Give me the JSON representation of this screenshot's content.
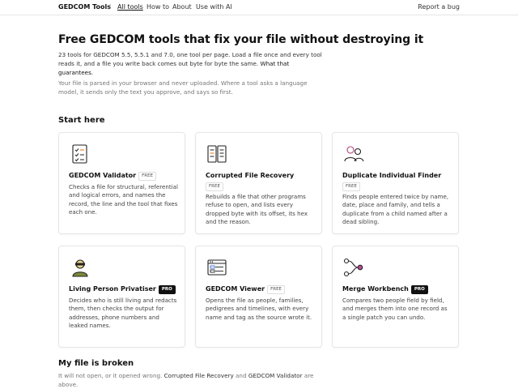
{
  "header": {
    "brand": "GEDCOM Tools",
    "separator": "/",
    "nav": [
      "All tools",
      "How to",
      "About",
      "Use with AI"
    ],
    "report": "Report a bug"
  },
  "hero": {
    "title": "Free GEDCOM tools that fix your file without destroying it",
    "intro_a": "23 tools for GEDCOM 5.5, 5.5.1 and 7.0, one tool per page. Load a file once and every tool reads it, and a file you write back comes out byte for byte the same.",
    "intro_link": "What that guarantees.",
    "note": "Your file is parsed in your browser and never uploaded. Where a tool asks a language model, it sends only the text you approve, and says so first."
  },
  "start_here": {
    "heading": "Start here",
    "cards": [
      {
        "title": "GEDCOM Validator",
        "badge": "FREE",
        "icon": "checklist-icon",
        "desc": "Checks a file for structural, referential and logical errors, and names the record, the line and the tool that fixes each one."
      },
      {
        "title": "Corrupted File Recovery",
        "badge": "FREE",
        "icon": "file-repair-icon",
        "desc": "Rebuilds a file that other programs refuse to open, and lists every dropped byte with its offset, its hex and the reason."
      },
      {
        "title": "Duplicate Individual Finder",
        "badge": "FREE",
        "icon": "people-icon",
        "desc": "Finds people entered twice by name, date, place and family, and tells a duplicate from a child named after a dead sibling."
      },
      {
        "title": "Living Person Privatiser",
        "badge": "PRO",
        "icon": "privacy-person-icon",
        "desc": "Decides who is still living and redacts them, then checks the output for addresses, phone numbers and leaked names."
      },
      {
        "title": "GEDCOM Viewer",
        "badge": "FREE",
        "icon": "viewer-window-icon",
        "desc": "Opens the file as people, families, pedigrees and timelines, with every name and tag as the source wrote it."
      },
      {
        "title": "Merge Workbench",
        "badge": "PRO",
        "icon": "merge-icon",
        "desc": "Compares two people field by field, and merges them into one record as a single patch you can undo."
      }
    ]
  },
  "broken": {
    "heading": "My file is broken",
    "text_a": "It will not open, or it opened wrong.",
    "link_a": "Corrupted File Recovery",
    "text_and": "and",
    "link_b": "GEDCOM Validator",
    "text_b": "are above."
  }
}
